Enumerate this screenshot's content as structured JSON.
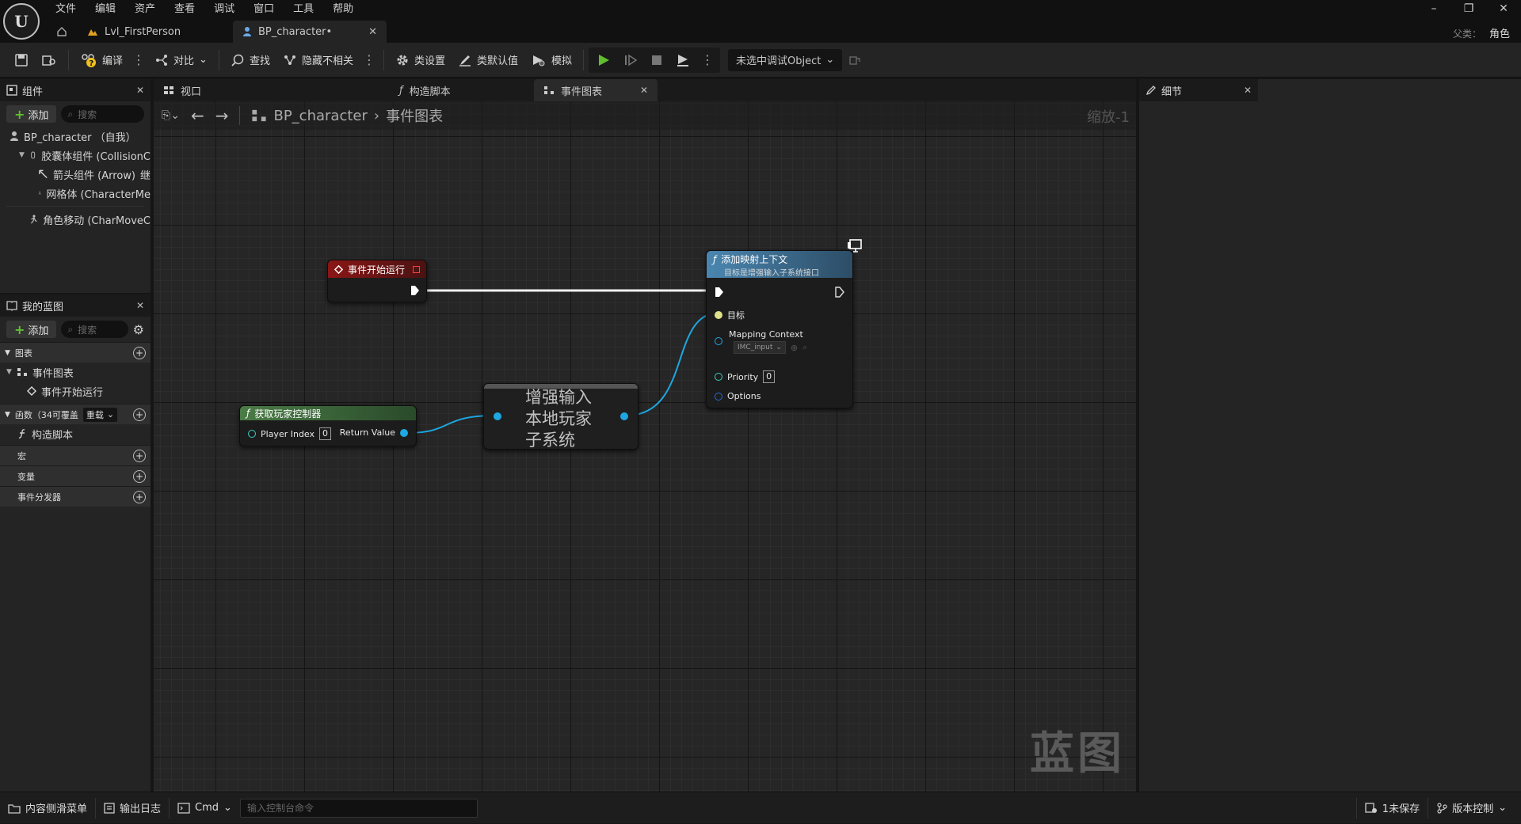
{
  "menu": [
    "文件",
    "编辑",
    "资产",
    "查看",
    "调试",
    "窗口",
    "工具",
    "帮助"
  ],
  "logo": "U",
  "doc_tabs": [
    {
      "label": "Lvl_FirstPerson"
    },
    {
      "label": "BP_character•"
    }
  ],
  "parent_class": {
    "label": "父类：",
    "value": "角色"
  },
  "window_controls": [
    "–",
    "❐",
    "✕"
  ],
  "toolbar": {
    "compile": "编译",
    "diff": "对比",
    "find": "查找",
    "hide_unrelated": "隐藏不相关",
    "class_settings": "类设置",
    "class_defaults": "类默认值",
    "simulate": "模拟",
    "debug_object": "未选中调试Object"
  },
  "components_panel": {
    "title": "组件",
    "add": "添加",
    "search_placeholder": "搜索",
    "items": [
      "BP_character （自我）",
      "胶囊体组件 (CollisionC",
      "箭头组件 (Arrow)",
      "网格体 (CharacterMe",
      "角色移动 (CharMoveC"
    ],
    "arrow_suffix": "继"
  },
  "my_blueprint": {
    "title": "我的蓝图",
    "add": "添加",
    "search_placeholder": "搜索",
    "graphs_label": "图表",
    "event_graph": "事件图表",
    "begin_play": "事件开始运行",
    "functions_label": "函数（34可覆盖",
    "override": "重载",
    "construction": "构造脚本",
    "macros": "宏",
    "variables": "变量",
    "dispatchers": "事件分发器"
  },
  "graph_tabs": [
    {
      "label": "视口"
    },
    {
      "label": "构造脚本"
    },
    {
      "label": "事件图表"
    }
  ],
  "breadcrumb": {
    "root": "BP_character",
    "current": "事件图表"
  },
  "zoom": "缩放-1",
  "watermark": "蓝图",
  "nodes": {
    "begin_play": {
      "title": "事件开始运行"
    },
    "get_controller": {
      "title": "获取玩家控制器",
      "pin_in": "Player Index",
      "pin_in_value": "0",
      "pin_out": "Return Value"
    },
    "subsystem": {
      "title": "增强输入\n本地玩家\n子系统"
    },
    "add_mapping": {
      "title": "添加映射上下文",
      "subtitle": "目标是增强输入子系统接口",
      "target": "目标",
      "mapping_context": "Mapping Context",
      "mapping_value": "IMC_input",
      "priority": "Priority",
      "priority_value": "0",
      "options": "Options"
    }
  },
  "details_panel": {
    "title": "细节"
  },
  "statusbar": {
    "content_drawer": "内容侧滑菜单",
    "output_log": "输出日志",
    "cmd": "Cmd",
    "cmd_placeholder": "输入控制台命令",
    "unsaved": "1未保存",
    "source_control": "版本控制"
  },
  "colors": {
    "event_header": "#8a1616",
    "pure_header": "#3d6b3b",
    "func_header": "#3a6a8a",
    "exec_wire": "#ffffff",
    "object_pin": "#1ea7e1",
    "struct_pin": "#3ad0c0"
  }
}
